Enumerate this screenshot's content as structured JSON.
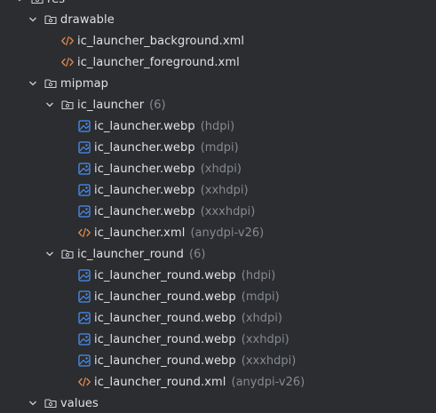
{
  "tree": {
    "top_folder": "res",
    "drawable": {
      "label": "drawable",
      "files": [
        {
          "name": "ic_launcher_background.xml"
        },
        {
          "name": "ic_launcher_foreground.xml"
        }
      ]
    },
    "mipmap": {
      "label": "mipmap",
      "ic_launcher": {
        "label": "ic_launcher",
        "count": "(6)",
        "files": [
          {
            "name": "ic_launcher.webp",
            "qualifier": "(hdpi)"
          },
          {
            "name": "ic_launcher.webp",
            "qualifier": "(mdpi)"
          },
          {
            "name": "ic_launcher.webp",
            "qualifier": "(xhdpi)"
          },
          {
            "name": "ic_launcher.webp",
            "qualifier": "(xxhdpi)"
          },
          {
            "name": "ic_launcher.webp",
            "qualifier": "(xxxhdpi)"
          },
          {
            "name": "ic_launcher.xml",
            "qualifier": "(anydpi-v26)"
          }
        ]
      },
      "ic_launcher_round": {
        "label": "ic_launcher_round",
        "count": "(6)",
        "files": [
          {
            "name": "ic_launcher_round.webp",
            "qualifier": "(hdpi)"
          },
          {
            "name": "ic_launcher_round.webp",
            "qualifier": "(mdpi)"
          },
          {
            "name": "ic_launcher_round.webp",
            "qualifier": "(xhdpi)"
          },
          {
            "name": "ic_launcher_round.webp",
            "qualifier": "(xxhdpi)"
          },
          {
            "name": "ic_launcher_round.webp",
            "qualifier": "(xxxhdpi)"
          },
          {
            "name": "ic_launcher_round.xml",
            "qualifier": "(anydpi-v26)"
          }
        ]
      }
    },
    "values": {
      "label": "values"
    }
  },
  "colors": {
    "background": "#2b2d30",
    "text": "#dfe1e5",
    "hint": "#868a91",
    "xml_icon": "#e0894f",
    "image_icon": "#4a8ef0",
    "folder_icon": "#ced0d6",
    "chevron": "#ced0d6"
  },
  "icons": {
    "chevron_expanded": "chevron-down-icon",
    "folder": "folder-icon",
    "xml_file": "xml-file-icon",
    "image_file": "image-file-icon"
  }
}
